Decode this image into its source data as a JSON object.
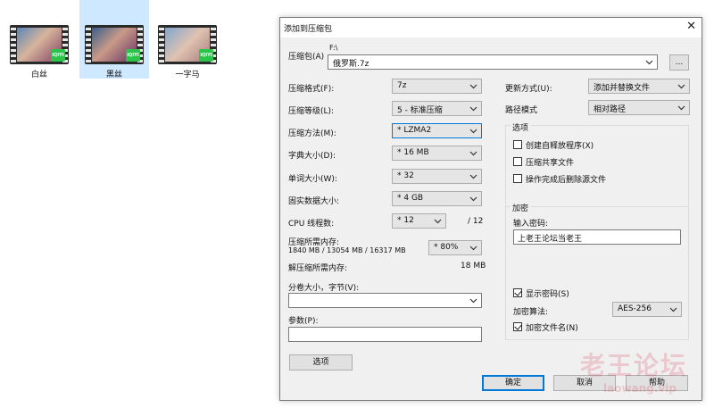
{
  "desktop": {
    "files": [
      {
        "name": "白丝",
        "badge": "iQIYI"
      },
      {
        "name": "黑丝",
        "badge": "iQIYI"
      },
      {
        "name": "一字马",
        "badge": "iQIYI"
      }
    ]
  },
  "dialog": {
    "title": "添加到压缩包",
    "archive_label": "压缩包(A)",
    "archive_path": "F:\\",
    "archive_name": "俄罗斯.7z",
    "browse_label": "...",
    "format_label": "压缩格式(F):",
    "format_value": "7z",
    "level_label": "压缩等级(L):",
    "level_value": "5 - 标准压缩",
    "method_label": "压缩方法(M):",
    "method_value": "* LZMA2",
    "dict_label": "字典大小(D):",
    "dict_value": "* 16 MB",
    "word_label": "单词大小(W):",
    "word_value": "* 32",
    "solid_label": "固实数据大小:",
    "solid_value": "* 4 GB",
    "threads_label": "CPU 线程数:",
    "threads_value": "* 12",
    "threads_total": "/ 12",
    "mem_label": "压缩所需内存:",
    "mem_values": "1840 MB / 13054 MB / 16317 MB",
    "mem_percent": "* 80%",
    "decomp_label": "解压缩所需内存:",
    "decomp_value": "18 MB",
    "split_label": "分卷大小，字节(V):",
    "split_value": "",
    "params_label": "参数(P):",
    "params_value": "",
    "options_button": "选项",
    "update_label": "更新方式(U):",
    "update_value": "添加并替换文件",
    "pathmode_label": "路径模式",
    "pathmode_value": "相对路径",
    "options_group": "选项",
    "opt_sfx": "创建自释放程序(X)",
    "opt_shared": "压缩共享文件",
    "opt_delete": "操作完成后删除源文件",
    "encrypt_group": "加密",
    "password_label": "输入密码:",
    "password_value": "上老王论坛当老王",
    "show_password": "显示密码(S)",
    "enc_method_label": "加密算法:",
    "enc_method_value": "AES-256",
    "encrypt_names": "加密文件名(N)",
    "ok": "确定",
    "cancel": "取消",
    "help": "帮助"
  },
  "watermark": {
    "text": "老王论坛",
    "url": "laowang.vip"
  },
  "colors": {
    "accent": "#0078d7",
    "selection": "#cde8ff",
    "iqiyi": "#2bc34a"
  }
}
